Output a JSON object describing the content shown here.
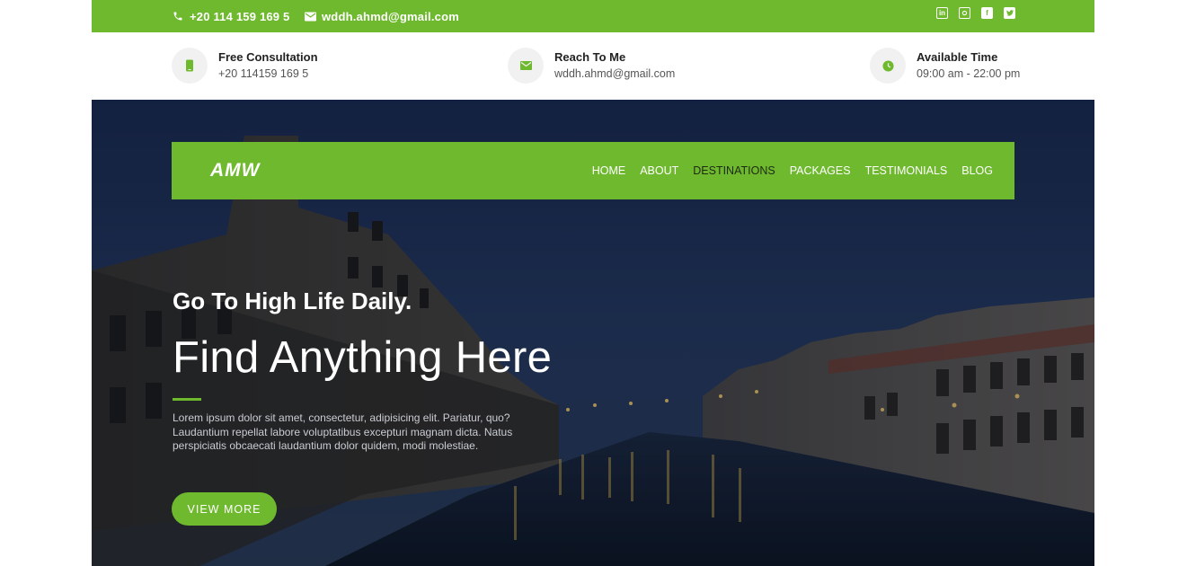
{
  "topbar": {
    "phone": "+20 114 159 169 5",
    "email": "wddh.ahmd@gmail.com",
    "phone_icon": "phone-icon",
    "email_icon": "envelope-icon",
    "socials": [
      "linkedin-icon",
      "instagram-icon",
      "facebook-icon",
      "twitter-icon"
    ],
    "accent_color": "#6fb92f"
  },
  "info": [
    {
      "title": "Free Consultation",
      "value": "+20 114159 169 5",
      "icon": "mobile-icon"
    },
    {
      "title": "Reach To Me",
      "value": "wddh.ahmd@gmail.com",
      "icon": "envelope-icon"
    },
    {
      "title": "Available Time",
      "value": "09:00 am - 22:00 pm",
      "icon": "clock-icon"
    }
  ],
  "nav": {
    "logo": "AMW",
    "items": [
      "HOME",
      "ABOUT",
      "DESTINATIONS",
      "PACKAGES",
      "TESTIMONIALS",
      "BLOG"
    ],
    "active": "DESTINATIONS"
  },
  "hero": {
    "subtitle": "Go To High Life Daily.",
    "title": "Find Anything Here",
    "text": "Lorem ipsum dolor sit amet, consectetur, adipisicing elit. Pariatur, quo? Laudantium repellat labore voluptatibus excepturi magnam dicta. Natus perspiciatis obcaecati laudantium dolor quidem, modi molestiae.",
    "button": "VIEW MORE"
  }
}
